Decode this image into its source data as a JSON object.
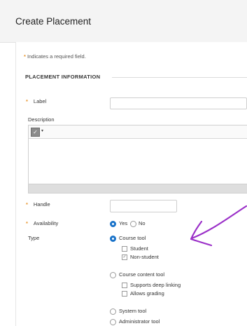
{
  "header": {
    "title": "Create Placement"
  },
  "required_note": {
    "star": "*",
    "text": "Indicates a required field."
  },
  "section": {
    "heading": "PLACEMENT INFORMATION"
  },
  "fields": {
    "label": {
      "star": "*",
      "text": "Label",
      "value": ""
    },
    "description": {
      "text": "Description",
      "toolbar_icon": "spellcheck-icon",
      "toolbar_caret": "▾"
    },
    "handle": {
      "star": "*",
      "text": "Handle",
      "value": ""
    },
    "availability": {
      "star": "*",
      "text": "Availability",
      "options": [
        {
          "label": "Yes",
          "selected": true
        },
        {
          "label": "No",
          "selected": false
        }
      ]
    },
    "type": {
      "text": "Type",
      "course_tool": {
        "label": "Course tool",
        "selected": true,
        "sub": [
          {
            "label": "Student",
            "checked": false
          },
          {
            "label": "Non-student",
            "checked": true
          }
        ]
      },
      "course_content_tool": {
        "label": "Course content tool",
        "selected": false,
        "sub": [
          {
            "label": "Supports deep linking",
            "checked": false
          },
          {
            "label": "Allows grading",
            "checked": false
          }
        ]
      },
      "system_tool": {
        "label": "System tool",
        "selected": false
      },
      "administrator_tool": {
        "label": "Administrator tool",
        "selected": false
      }
    }
  },
  "colors": {
    "required_star": "#e8962e",
    "radio_selected": "#1a73c9",
    "annotation_arrow": "#9b30c8"
  },
  "check_glyph": "✓"
}
